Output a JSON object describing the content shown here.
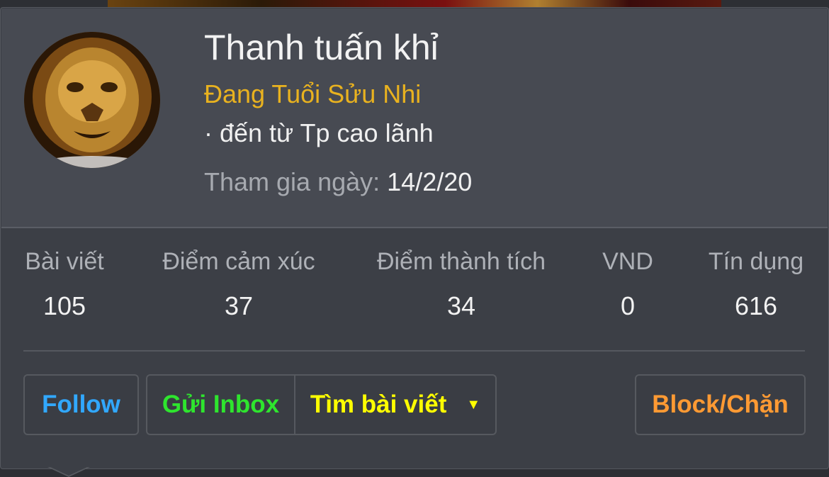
{
  "profile": {
    "name": "Thanh tuấn khỉ",
    "title": "Đang Tuổi Sửu Nhi",
    "location": "· đến từ Tp cao lãnh",
    "joined_label": "Tham gia ngày:",
    "joined_value": "14/2/20",
    "avatar_icon": "lion-avatar"
  },
  "stats": [
    {
      "label": "Bài viết",
      "value": "105"
    },
    {
      "label": "Điểm cảm xúc",
      "value": "37"
    },
    {
      "label": "Điểm thành tích",
      "value": "34"
    },
    {
      "label": "VND",
      "value": "0"
    },
    {
      "label": "Tín dụng",
      "value": "616"
    }
  ],
  "actions": {
    "follow": "Follow",
    "inbox": "Gửi Inbox",
    "search_posts": "Tìm bài viết",
    "block": "Block/Chặn"
  },
  "colors": {
    "follow": "#31a8ff",
    "inbox": "#2ee52e",
    "search": "#ffff00",
    "block": "#ff9a33",
    "title": "#e9b21f"
  }
}
